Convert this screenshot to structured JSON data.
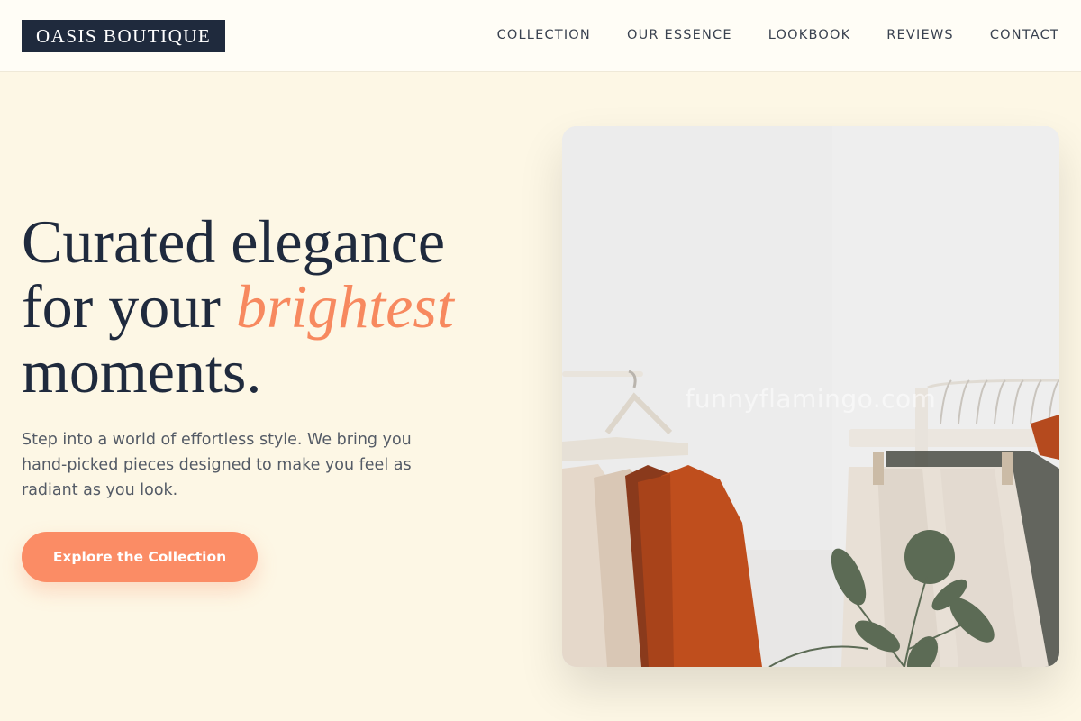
{
  "brand": {
    "name": "OASIS BOUTIQUE"
  },
  "nav": {
    "items": [
      {
        "label": "COLLECTION"
      },
      {
        "label": "OUR ESSENCE"
      },
      {
        "label": "LOOKBOOK"
      },
      {
        "label": "REVIEWS"
      },
      {
        "label": "CONTACT"
      }
    ]
  },
  "hero": {
    "title_line1": "Curated elegance",
    "title_line2_pre": "for your ",
    "title_accent": "brightest",
    "title_line3": "moments.",
    "subtitle": "Step into a world of effortless style. We bring you hand-picked pieces designed to make you feel as radiant as you look.",
    "cta_label": "Explore the Collection",
    "image_watermark": "funnyflamingo.com"
  },
  "colors": {
    "background": "#fdf7e5",
    "brand_dark": "#1f2a3d",
    "accent": "#f7895f",
    "button": "#fb8c65"
  }
}
